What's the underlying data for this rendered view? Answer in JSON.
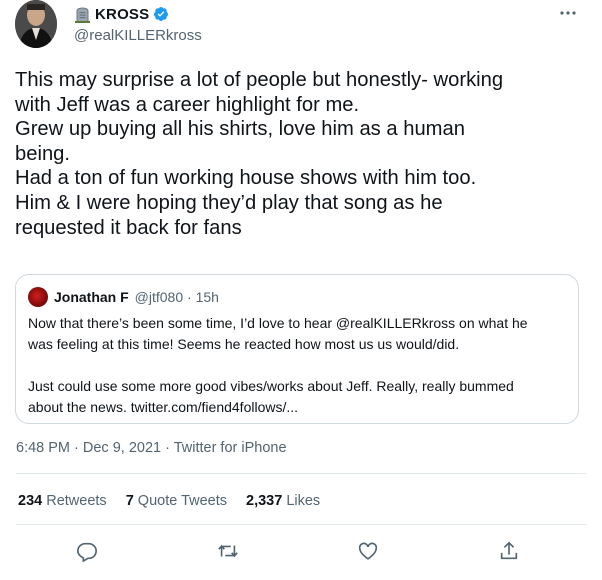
{
  "author": {
    "display_name": "KROSS",
    "handle": "@realKILLERkross",
    "name_emoji_icon": "headstone-emoji-icon",
    "verified_icon": "verified-badge-icon"
  },
  "tweet": {
    "lines": [
      "This may surprise a lot of people but honestly- working",
      "with Jeff was a career highlight for me.",
      "Grew up buying all his shirts, love him as a human",
      "being.",
      "Had a ton of fun working house shows with him too.",
      "Him & I were hoping they’d play that song as he",
      "requested it back for fans"
    ]
  },
  "quote": {
    "name": "Jonathan F",
    "handle_time": "@jtf080 · 15h",
    "lines_1": [
      "Now that there’s been some time, I’d love to hear @realKILLERkross on what he",
      "was feeling at this time! Seems he reacted how most us us would/did."
    ],
    "lines_2": [
      "Just could use some more good vibes/works about Jeff. Really, really bummed",
      "about the news. twitter.com/fiend4follows/..."
    ]
  },
  "meta": {
    "timestamp": "6:48 PM · Dec 9, 2021 · Twitter for iPhone"
  },
  "stats": {
    "retweets_count": "234",
    "retweets_label": "Retweets",
    "quote_count": "7",
    "quote_label": "Quote Tweets",
    "likes_count": "2,337",
    "likes_label": "Likes"
  },
  "colors": {
    "text": "#0f1419",
    "secondary": "#536471",
    "verified": "#1d9bf0",
    "border": "#cfd9de"
  }
}
